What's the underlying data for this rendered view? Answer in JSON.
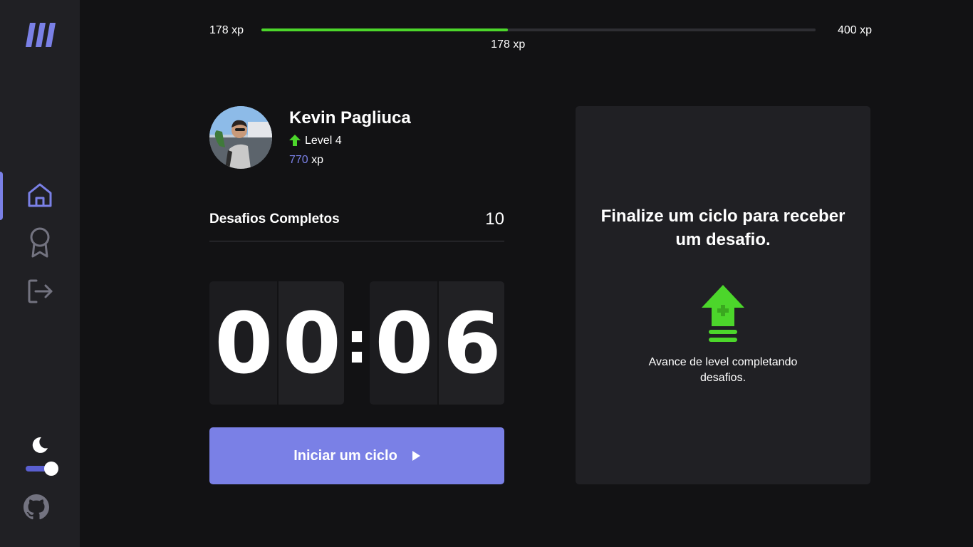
{
  "sidebar": {
    "logo": "logo-icon",
    "nav": [
      {
        "name": "home",
        "icon": "home-icon",
        "active": true
      },
      {
        "name": "ranking",
        "icon": "award-icon",
        "active": false
      },
      {
        "name": "logout",
        "icon": "logout-icon",
        "active": false
      }
    ],
    "theme_toggle": {
      "icon": "moon-icon",
      "dark_mode": true
    },
    "github": "github-icon"
  },
  "xp_bar": {
    "min_label": "178 xp",
    "max_label": "400 xp",
    "current_label": "178 xp",
    "progress": 0.445
  },
  "profile": {
    "name": "Kevin Pagliuca",
    "level_label": "Level 4",
    "xp_value": "770",
    "xp_unit": "xp"
  },
  "challenges": {
    "label": "Desafios Completos",
    "count": "10"
  },
  "countdown": {
    "minutes": [
      "0",
      "0"
    ],
    "seconds": [
      "0",
      "6"
    ],
    "separator": ":"
  },
  "start_button": {
    "label": "Iniciar um ciclo",
    "icon": "play-icon"
  },
  "challenge_card": {
    "title": "Finalize um ciclo para receber um desafio.",
    "description": "Avance de level completando desafios.",
    "icon": "level-up-icon"
  },
  "colors": {
    "background": "#121214",
    "surface": "#202024",
    "accent": "#7a80e6",
    "green": "#4cd62b"
  }
}
